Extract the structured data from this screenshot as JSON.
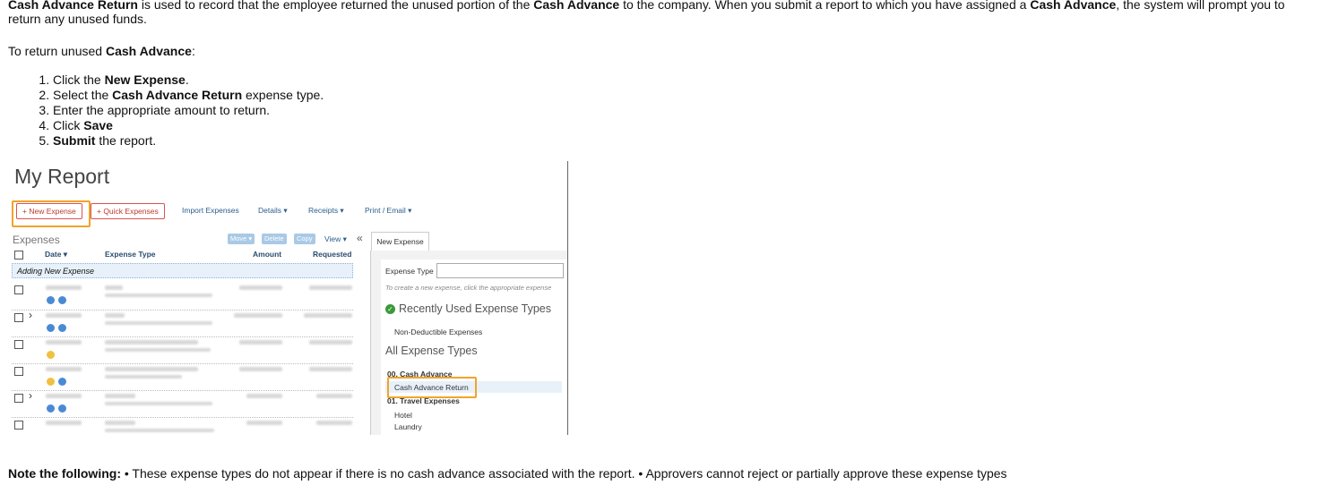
{
  "intro": {
    "b1": "Cash Advance Return",
    "t1": " is used to record that the employee returned the unused portion of the ",
    "b2": "Cash Advance",
    "t2": " to the company. When you submit a report to which you have assigned a ",
    "b3": "Cash Advance",
    "t3": ", the system will prompt you to return any unused funds."
  },
  "para2": {
    "t1": "To return unused ",
    "b1": "Cash Advance",
    "t2": ":"
  },
  "steps": [
    {
      "pre": "Click the ",
      "bold": "New Expense",
      "post": "."
    },
    {
      "pre": "Select the ",
      "bold": "Cash Advance Return",
      "post": " expense type."
    },
    {
      "pre": "Enter the appropriate amount to return.",
      "bold": "",
      "post": ""
    },
    {
      "pre": "Click ",
      "bold": "Save",
      "post": ""
    },
    {
      "pre": "",
      "bold": "Submit",
      "post": " the report."
    }
  ],
  "screenshot": {
    "title": "My Report",
    "toolbar": {
      "new_expense": "+ New Expense",
      "quick_expenses": "+ Quick Expenses",
      "import_expenses": "Import Expenses",
      "details": "Details ▾",
      "receipts": "Receipts ▾",
      "print_email": "Print / Email ▾"
    },
    "expenses_label": "Expenses",
    "grid_buttons": {
      "move": "Move ▾",
      "delete": "Delete",
      "copy": "Copy",
      "view": "View ▾",
      "collapse": "«"
    },
    "columns": {
      "date": "Date ▾",
      "expense_type": "Expense Type",
      "amount": "Amount",
      "requested": "Requested"
    },
    "adding_row": "Adding New Expense",
    "panel": {
      "tab": "New Expense",
      "expense_type_label": "Expense Type",
      "hint": "To create a new expense, click the appropriate expense",
      "recent_heading": "Recently Used Expense Types",
      "recent_items": [
        "Non-Deductible Expenses"
      ],
      "all_heading": "All Expense Types",
      "group1": "00. Cash Advance",
      "cash_advance_return": "Cash Advance Return",
      "group2": "01. Travel Expenses",
      "items": [
        "Hotel",
        "Laundry"
      ]
    }
  },
  "note": {
    "bold": "Note the following:",
    "text": " • These expense types do not appear if there is no cash advance associated with the report. • Approvers cannot reject or partially approve these expense types"
  }
}
